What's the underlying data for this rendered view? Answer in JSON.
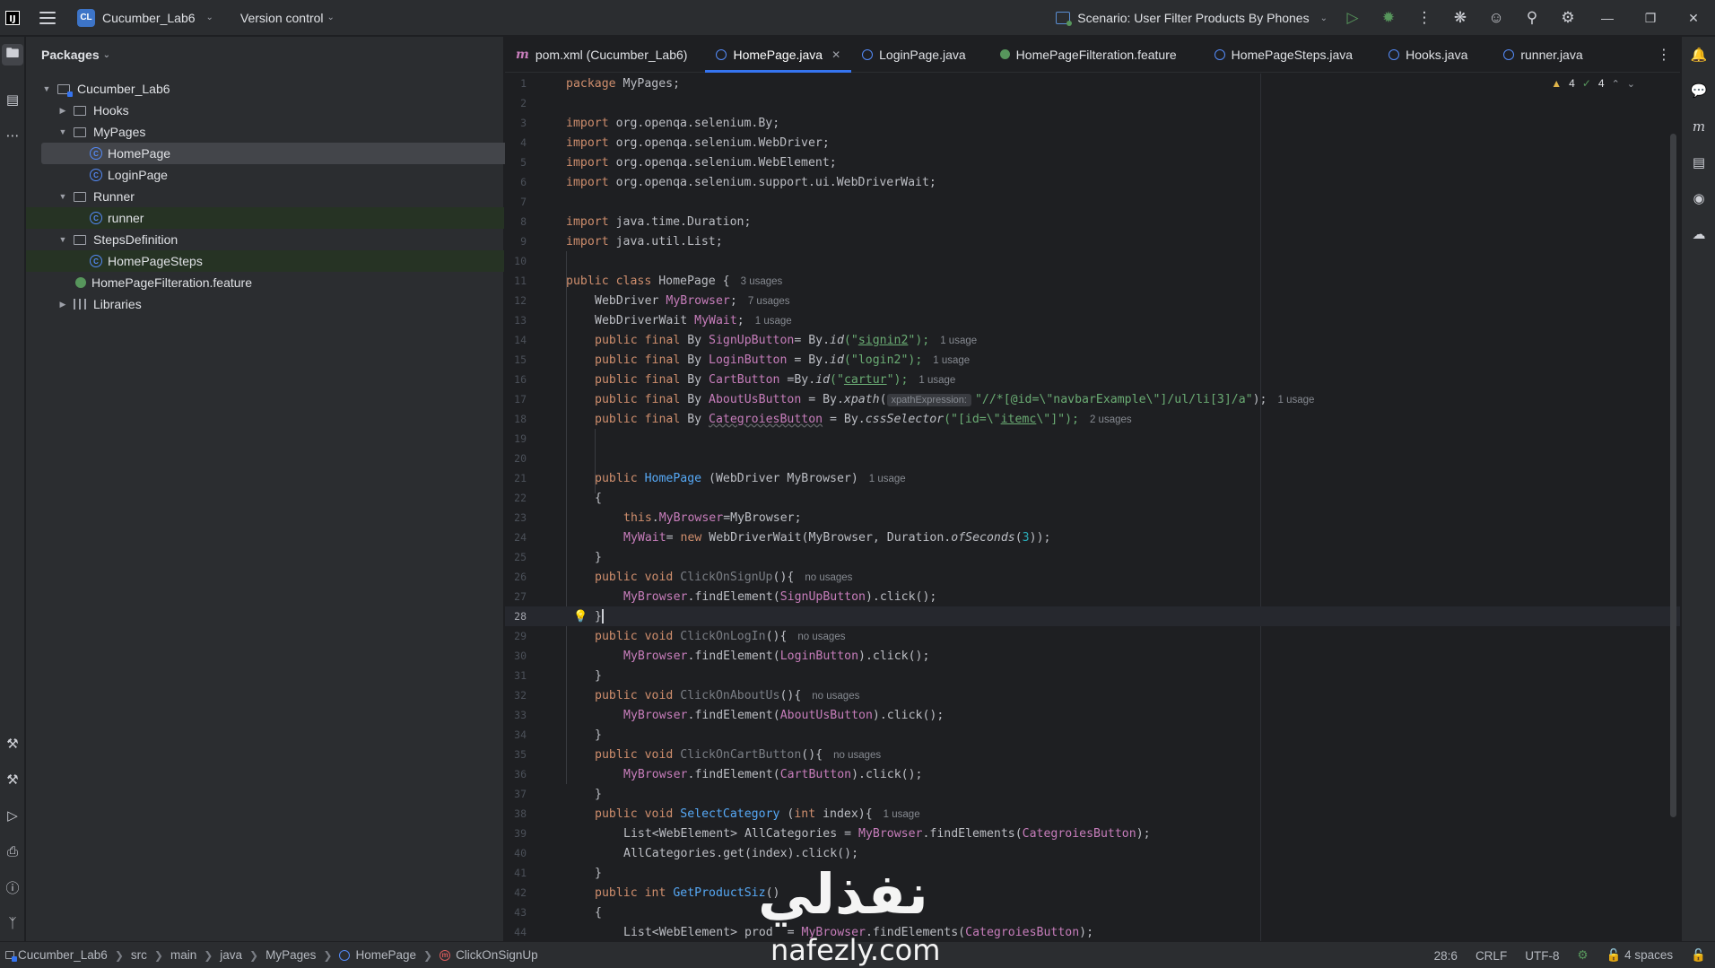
{
  "titlebar": {
    "project_badge": "CL",
    "project_name": "Cucumber_Lab6",
    "vcs_label": "Version control",
    "run_config": "Scenario: User Filter Products By Phones"
  },
  "project_panel": {
    "header": "Packages",
    "tree": [
      {
        "label": "Cucumber_Lab6",
        "icon": "module-folder-icon",
        "expanded": true
      },
      {
        "label": "Hooks",
        "icon": "package-folder-icon",
        "expanded": false
      },
      {
        "label": "MyPages",
        "icon": "package-folder-icon",
        "expanded": true
      },
      {
        "label": "HomePage",
        "icon": "java-class-icon"
      },
      {
        "label": "LoginPage",
        "icon": "java-class-icon"
      },
      {
        "label": "Runner",
        "icon": "package-folder-icon",
        "expanded": true
      },
      {
        "label": "runner",
        "icon": "java-class-icon"
      },
      {
        "label": "StepsDefinition",
        "icon": "package-folder-icon",
        "expanded": true
      },
      {
        "label": "HomePageSteps",
        "icon": "java-class-icon"
      },
      {
        "label": "HomePageFilteration.feature",
        "icon": "cucumber-feature-icon"
      },
      {
        "label": "Libraries",
        "icon": "libraries-icon",
        "expanded": false
      }
    ]
  },
  "tabs": [
    {
      "label": "pom.xml (Cucumber_Lab6)",
      "icon": "maven-icon"
    },
    {
      "label": "HomePage.java",
      "icon": "java-class-icon",
      "active": true
    },
    {
      "label": "LoginPage.java",
      "icon": "java-class-icon"
    },
    {
      "label": "HomePageFilteration.feature",
      "icon": "cucumber-feature-icon"
    },
    {
      "label": "HomePageSteps.java",
      "icon": "java-class-icon"
    },
    {
      "label": "Hooks.java",
      "icon": "java-class-icon"
    },
    {
      "label": "runner.java",
      "icon": "java-class-icon"
    }
  ],
  "inspections": {
    "warnings": "4",
    "checks": "4"
  },
  "editor": {
    "current_line": 28,
    "line_numbers": [
      "1",
      "2",
      "3",
      "4",
      "5",
      "6",
      "7",
      "8",
      "9",
      "10",
      "11",
      "12",
      "13",
      "14",
      "15",
      "16",
      "17",
      "18",
      "19",
      "20",
      "21",
      "22",
      "23",
      "24",
      "25",
      "26",
      "27",
      "28",
      "29",
      "30",
      "31",
      "32",
      "33",
      "34",
      "35",
      "36",
      "37",
      "38",
      "39",
      "40",
      "41",
      "42",
      "43",
      "44"
    ],
    "lines": {
      "l1": [
        "package ",
        "MyPages",
        ";"
      ],
      "l3": [
        "import ",
        "org.openqa.selenium.By;"
      ],
      "l4": [
        "import ",
        "org.openqa.selenium.WebDriver;"
      ],
      "l5": [
        "import ",
        "org.openqa.selenium.WebElement;"
      ],
      "l6": [
        "import ",
        "org.openqa.selenium.support.ui.WebDriverWait;"
      ],
      "l8": [
        "import ",
        "java.time.Duration;"
      ],
      "l9": [
        "import ",
        "java.util.List;"
      ],
      "l11": [
        "public class ",
        "HomePage {",
        "3 usages"
      ],
      "l12": [
        "WebDriver ",
        "MyBrowser",
        ";",
        "7 usages"
      ],
      "l13": [
        "WebDriverWait ",
        "MyWait",
        ";",
        "1 usage"
      ],
      "l14": [
        "public final ",
        "By ",
        "SignUpButton",
        "= By.",
        "id",
        "(\"",
        "signin2",
        "\");",
        "1 usage"
      ],
      "l15": [
        "public final ",
        "By ",
        "LoginButton",
        " = By.",
        "id",
        "(\"",
        "login2",
        "\");",
        "1 usage"
      ],
      "l16": [
        "public final ",
        "By ",
        "CartButton",
        " =By.",
        "id",
        "(\"",
        "cartur",
        "\");",
        "1 usage"
      ],
      "l17": [
        "public final ",
        "By ",
        "AboutUsButton",
        " = By.",
        "xpath",
        "(",
        "xpathExpression:",
        "\"//*[@id=\\\"navbarExample\\\"]/ul/li[3]/a\"",
        ");",
        "1 usage"
      ],
      "l18": [
        "public final ",
        "By ",
        "CategroiesButton",
        " = By.",
        "cssSelector",
        "(\"[id=\\\"",
        "itemc",
        "\\\"]\");",
        "2 usages"
      ],
      "l21": [
        "public ",
        "HomePage",
        " (WebDriver MyBrowser)",
        "1 usage"
      ],
      "l22": [
        "{"
      ],
      "l23": [
        "this",
        ".",
        "MyBrowser",
        "=MyBrowser;"
      ],
      "l24": [
        "MyWait",
        "= ",
        "new ",
        "WebDriverWait(MyBrowser, Duration.",
        "ofSeconds",
        "(",
        "3",
        "));"
      ],
      "l25": [
        "}"
      ],
      "l26": [
        "public void ",
        "ClickOnSignUp",
        "(){",
        "no usages"
      ],
      "l27": [
        "MyBrowser",
        ".findElement(",
        "SignUpButton",
        ").click();"
      ],
      "l28": [
        "}"
      ],
      "l29": [
        "public void ",
        "ClickOnLogIn",
        "(){",
        "no usages"
      ],
      "l30": [
        "MyBrowser",
        ".findElement(",
        "LoginButton",
        ").click();"
      ],
      "l31": [
        "}"
      ],
      "l32": [
        "public void ",
        "ClickOnAboutUs",
        "(){",
        "no usages"
      ],
      "l33": [
        "MyBrowser",
        ".findElement(",
        "AboutUsButton",
        ").click();"
      ],
      "l34": [
        "}"
      ],
      "l35": [
        "public void ",
        "ClickOnCartButton",
        "(){",
        "no usages"
      ],
      "l36": [
        "MyBrowser",
        ".findElement(",
        "CartButton",
        ").click();"
      ],
      "l37": [
        "}"
      ],
      "l38": [
        "public void ",
        "SelectCategory",
        " (",
        "int ",
        "index){",
        "1 usage"
      ],
      "l39": [
        "List<WebElement> AllCategories = ",
        "MyBrowser",
        ".findElements(",
        "CategroiesButton",
        ");"
      ],
      "l40": [
        "AllCategories.get(index).click();"
      ],
      "l41": [
        "}"
      ],
      "l42": [
        "public int ",
        "GetProductSiz",
        "()"
      ],
      "l43": [
        "{"
      ],
      "l44": [
        "List<WebElement> prod",
        "  = ",
        "MyBrowser",
        ".findElements(",
        "CategroiesButton",
        ");"
      ]
    }
  },
  "statusbar": {
    "breadcrumbs": [
      "Cucumber_Lab6",
      "src",
      "main",
      "java",
      "MyPages",
      "HomePage",
      "ClickOnSignUp"
    ],
    "position": "28:6",
    "line_separator": "CRLF",
    "encoding": "UTF-8",
    "indent": "4 spaces"
  },
  "watermark": {
    "arabic": "نفذلي",
    "url": "nafezly.com"
  }
}
